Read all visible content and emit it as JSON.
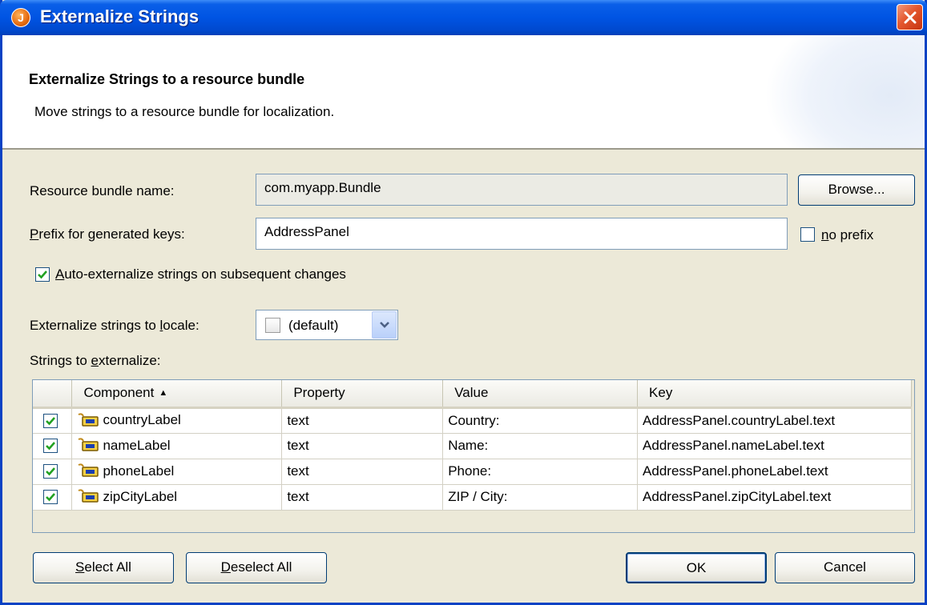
{
  "window": {
    "title": "Externalize Strings"
  },
  "banner": {
    "title": "Externalize Strings to a resource bundle",
    "description": "Move strings to a resource bundle for localization."
  },
  "form": {
    "bundle_label": "Resource bundle name:",
    "bundle_value": "com.myapp.Bundle",
    "browse_label": "Browse...",
    "prefix_label": "Prefix for generated keys:",
    "prefix_value": "AddressPanel",
    "no_prefix_label": "no prefix",
    "no_prefix_checked": false,
    "auto_label": "Auto-externalize strings on subsequent changes",
    "auto_checked": true,
    "locale_label": "Externalize strings to locale:",
    "locale_value": "(default)",
    "strings_label": "Strings to externalize:"
  },
  "table": {
    "columns": [
      "Component",
      "Property",
      "Value",
      "Key"
    ],
    "sort_indicator": "▲",
    "rows": [
      {
        "checked": true,
        "component": "countryLabel",
        "property": "text",
        "value": "Country:",
        "key": "AddressPanel.countryLabel.text"
      },
      {
        "checked": true,
        "component": "nameLabel",
        "property": "text",
        "value": "Name:",
        "key": "AddressPanel.nameLabel.text"
      },
      {
        "checked": true,
        "component": "phoneLabel",
        "property": "text",
        "value": "Phone:",
        "key": "AddressPanel.phoneLabel.text"
      },
      {
        "checked": true,
        "component": "zipCityLabel",
        "property": "text",
        "value": "ZIP / City:",
        "key": "AddressPanel.zipCityLabel.text"
      }
    ]
  },
  "buttons": {
    "select_all": "Select All",
    "deselect_all": "Deselect All",
    "ok": "OK",
    "cancel": "Cancel"
  },
  "colors": {
    "title_bar": "#0054e3",
    "dialog_bg": "#ece9d8",
    "checkmark": "#21a121",
    "close_button": "#e4572e"
  }
}
